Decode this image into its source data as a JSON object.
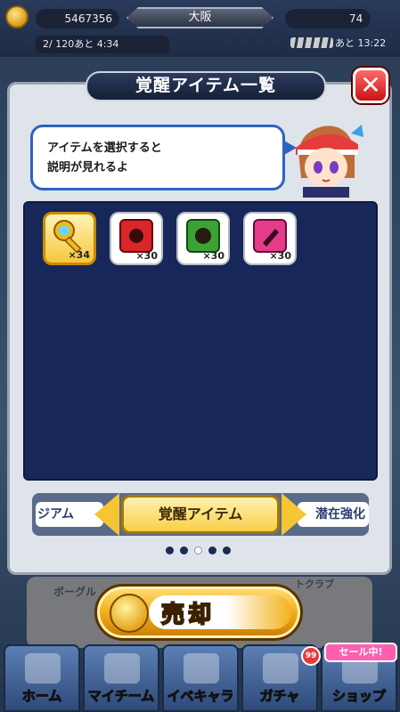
{
  "status_bar": {
    "money": "5467356",
    "city": "大阪",
    "stamina": "74",
    "timer": "2/ 120あと  4:34",
    "time_right": "あと 13:22"
  },
  "background": {
    "panel_left_text": "ボーグル",
    "panel_right_text": "トクラブ"
  },
  "modal": {
    "title": "覚醒アイテム一覧",
    "close_label": "✕",
    "speech_line1": "アイテムを選択すると",
    "speech_line2": "説明が見れるよ"
  },
  "items": [
    {
      "name": "key",
      "count": "×34",
      "color": "#f5c73c",
      "selected": true
    },
    {
      "name": "red-card",
      "count": "×30",
      "color": "#d8262b",
      "selected": false
    },
    {
      "name": "green-card",
      "count": "×30",
      "color": "#3ba336",
      "selected": false
    },
    {
      "name": "pink-card",
      "count": "×30",
      "color": "#e43c8a",
      "selected": false
    }
  ],
  "tabs": {
    "left": "ジアム",
    "center": "覚醒アイテム",
    "right": "潜在強化"
  },
  "pagination": {
    "total": 5,
    "active": 3
  },
  "sell_button": {
    "label": "売却"
  },
  "nav": [
    {
      "label": "ホーム"
    },
    {
      "label": "マイチーム"
    },
    {
      "label": "イベキャラ"
    },
    {
      "label": "ガチャ"
    },
    {
      "label": "ショップ"
    }
  ],
  "badges": {
    "gacha": "99",
    "sale": "セール中!"
  }
}
